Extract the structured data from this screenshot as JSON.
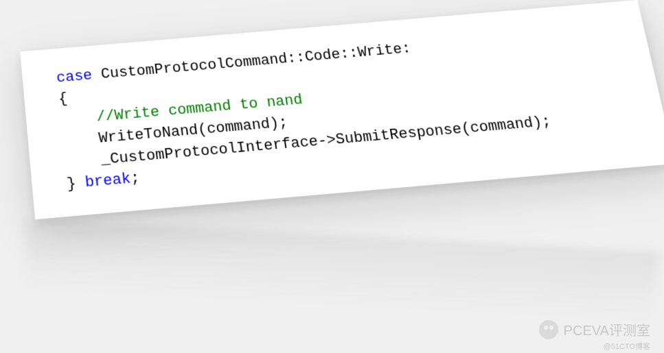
{
  "code": {
    "line1_keyword": "case",
    "line1_rest": " CustomProtocolCommand::Code::Write:",
    "line2": "{",
    "line3_comment": "    //Write command to nand",
    "line4": "    WriteToNand(command);",
    "line5": "    _CustomProtocolInterface->SubmitResponse(command);",
    "line6_brace": "} ",
    "line6_keyword": "break",
    "line6_semi": ";"
  },
  "watermark": {
    "text": "PCEVA评测室",
    "sub": "@51CTO博客"
  }
}
